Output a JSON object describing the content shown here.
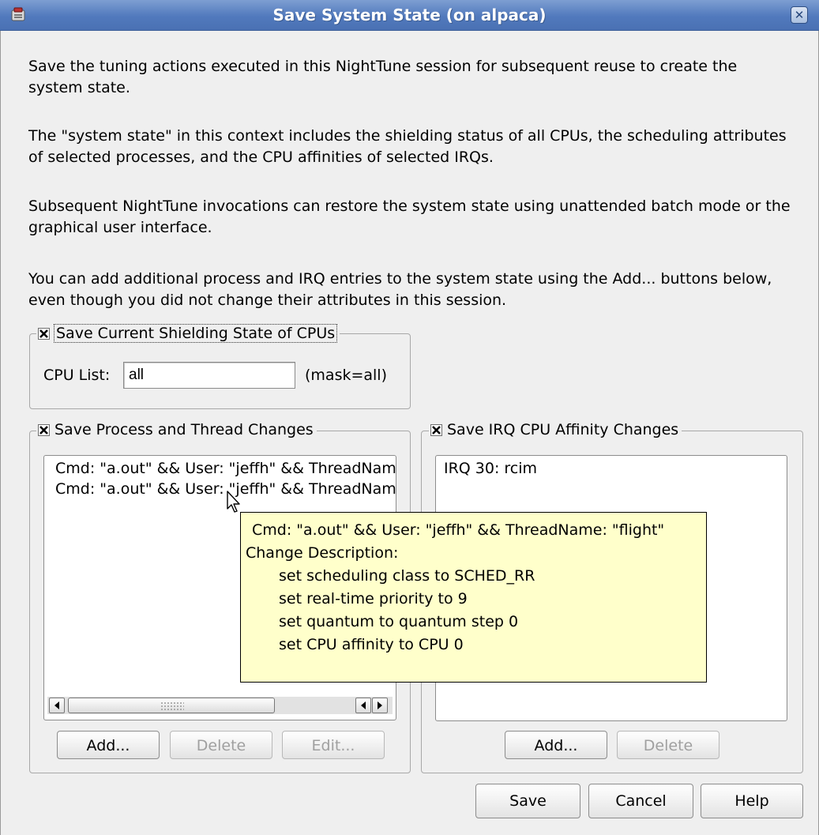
{
  "window": {
    "title": "Save System State (on alpaca)",
    "icon": "nighttune-app-icon",
    "close_icon": "close-icon"
  },
  "intro": {
    "p1": "Save the tuning actions executed in this NightTune session for subsequent reuse to create the system state.",
    "p2": "The \"system state\" in this context includes the shielding status of all CPUs, the scheduling attributes of selected processes, and the CPU affinities of selected IRQs.",
    "p3": "Subsequent NightTune invocations can restore the system state using unattended batch mode or the graphical user interface.",
    "p4": "You can add additional process and IRQ entries to the system state using the Add... buttons below, even though you did not change their attributes in this session."
  },
  "shielding": {
    "label": "Save Current Shielding State of CPUs",
    "checked": true,
    "cpu_list_label": "CPU List:",
    "cpu_list_value": "all",
    "mask_text": "(mask=all)"
  },
  "process": {
    "label": "Save Process and Thread Changes",
    "checked": true,
    "items": [
      "Cmd: \"a.out\" && User: \"jeffh\" && ThreadName: \"flight\"",
      "Cmd: \"a.out\" && User: \"jeffh\" && ThreadName: \"flight\""
    ],
    "scroll_fraction": 0.0,
    "add_label": "Add...",
    "delete_label": "Delete",
    "edit_label": "Edit..."
  },
  "irq": {
    "label": "Save IRQ CPU Affinity Changes",
    "checked": true,
    "items": [
      "IRQ 30:  rcim"
    ],
    "add_label": "Add...",
    "delete_label": "Delete"
  },
  "tooltip": {
    "header": "Cmd: \"a.out\" && User: \"jeffh\" && ThreadName: \"flight\"",
    "subheader": "Change Description:",
    "lines": [
      "set scheduling class to SCHED_RR",
      "set real-time priority to 9",
      "set quantum to quantum step 0",
      "set CPU affinity to CPU 0"
    ]
  },
  "footer": {
    "save_label": "Save",
    "cancel_label": "Cancel",
    "help_label": "Help"
  },
  "colors": {
    "titlebar": "#5179bd",
    "window_bg": "#efefef",
    "tooltip_bg": "#ffffcb"
  }
}
